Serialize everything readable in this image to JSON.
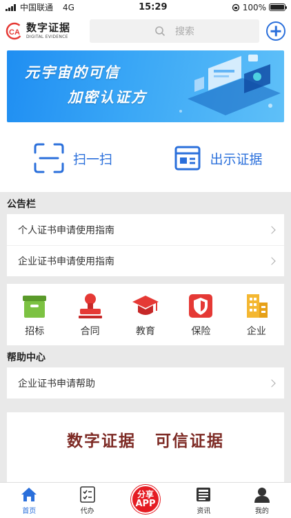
{
  "status_bar": {
    "carrier": "中国联通",
    "network": "4G",
    "time": "15:29",
    "battery_text": "100%",
    "battery_level": 1.0
  },
  "header": {
    "logo_cn": "数字证据",
    "logo_en": "DIGITAL EVIDENCE",
    "search_placeholder": "搜索",
    "accent_color": "#2a6fdb"
  },
  "banner": {
    "line1": "元宇宙的可信",
    "line2": "加密认证方"
  },
  "quick_actions": [
    {
      "label": "扫一扫",
      "icon": "scan-icon"
    },
    {
      "label": "出示证据",
      "icon": "evidence-card-icon"
    }
  ],
  "notice": {
    "title": "公告栏",
    "items": [
      {
        "label": "个人证书申请使用指南"
      },
      {
        "label": "企业证书申请使用指南"
      }
    ]
  },
  "categories": [
    {
      "label": "招标",
      "icon": "bidding-box-icon",
      "color": "#7cc242"
    },
    {
      "label": "合同",
      "icon": "stamp-icon",
      "color": "#e53935"
    },
    {
      "label": "教育",
      "icon": "graduation-cap-icon",
      "color": "#e53935"
    },
    {
      "label": "保险",
      "icon": "shield-icon",
      "color": "#e53935"
    },
    {
      "label": "企业",
      "icon": "building-icon",
      "color": "#f4b731"
    }
  ],
  "help": {
    "title": "帮助中心",
    "items": [
      {
        "label": "企业证书申请帮助"
      }
    ]
  },
  "promo": {
    "title_left": "数字证据",
    "title_right": "可信证据",
    "subtitle": ""
  },
  "tabbar": [
    {
      "label": "首页",
      "icon": "home-icon",
      "active": true
    },
    {
      "label": "代办",
      "icon": "todo-list-icon",
      "active": false
    },
    {
      "label": "",
      "icon": "share-app-icon",
      "active": false,
      "share_line1": "分享",
      "share_line2": "APP"
    },
    {
      "label": "资讯",
      "icon": "news-icon",
      "active": false
    },
    {
      "label": "我的",
      "icon": "user-icon",
      "active": false
    }
  ]
}
